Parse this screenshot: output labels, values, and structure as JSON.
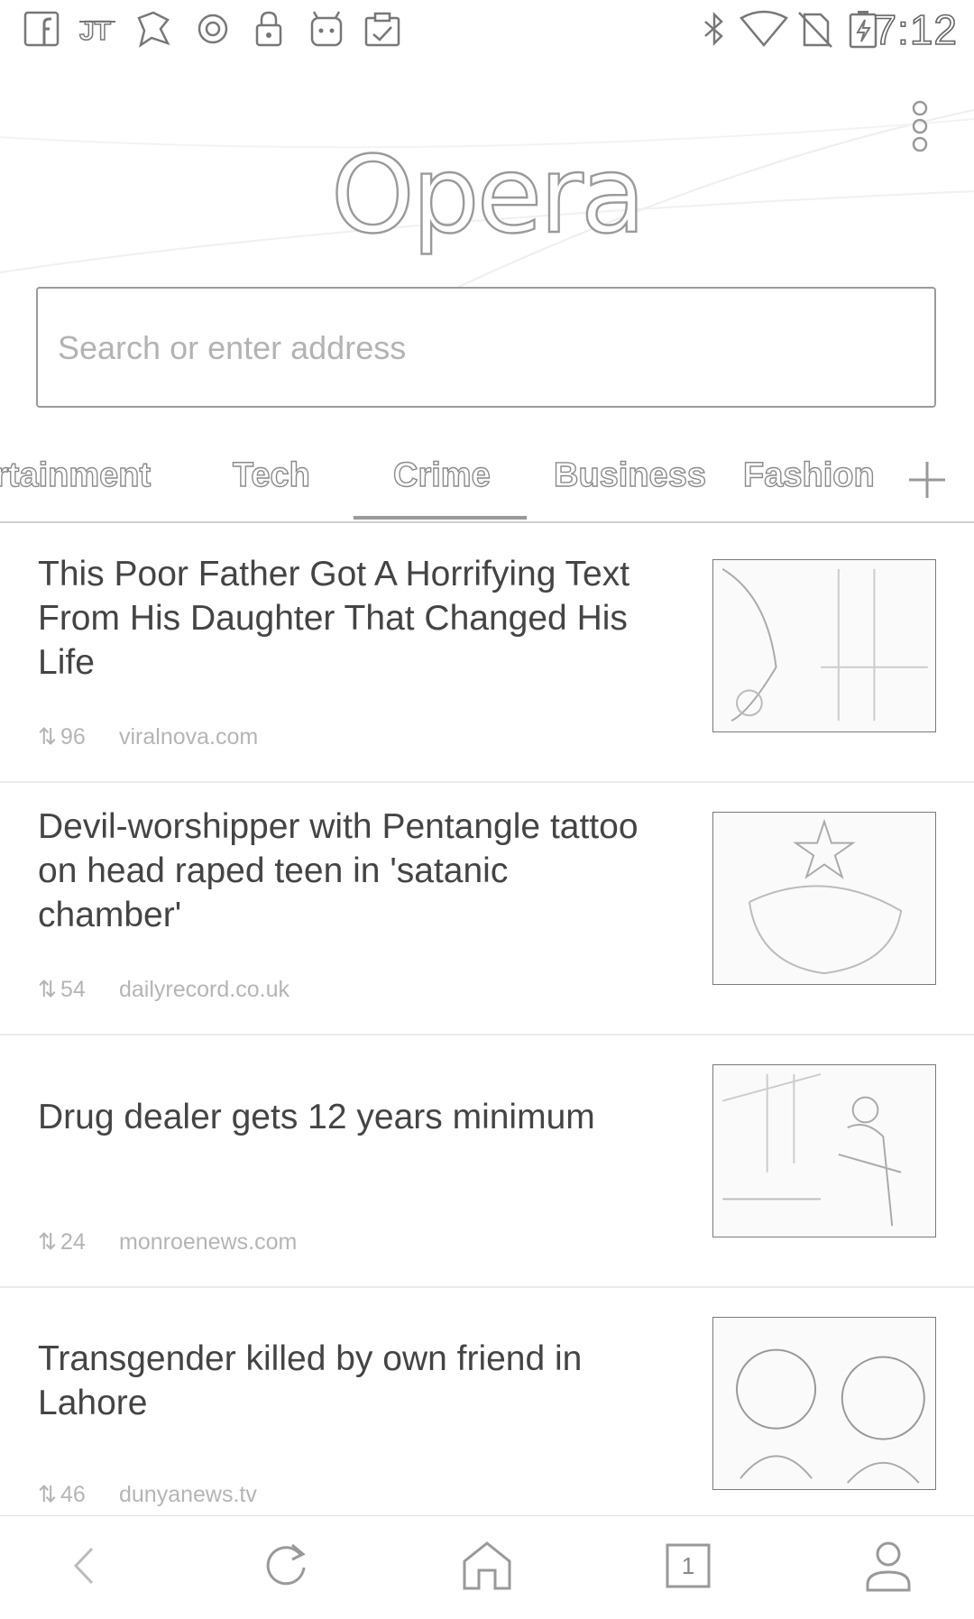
{
  "status_bar": {
    "time": "7:12",
    "left_icons": [
      "facebook-icon",
      "jt-app-icon",
      "app-icon",
      "circle-icon",
      "lock-icon",
      "robot-icon",
      "clipboard-check-icon"
    ],
    "right_icons": [
      "bluetooth-icon",
      "wifi-icon",
      "no-sim-icon",
      "battery-charging-icon"
    ]
  },
  "header": {
    "logo": "Opera"
  },
  "search": {
    "placeholder": "Search or enter address",
    "value": ""
  },
  "categories": {
    "items": [
      "rtainment",
      "Tech",
      "Crime",
      "Business",
      "Fashion"
    ],
    "selected": "Crime"
  },
  "feed": {
    "items": [
      {
        "title": "This Poor Father Got A Horrifying Text From His Daughter That Changed His Life",
        "shares": "96",
        "source": "viralnova.com"
      },
      {
        "title": "Devil-worshipper with Pentangle tattoo on head raped teen in 'satanic chamber'",
        "shares": "54",
        "source": "dailyrecord.co.uk"
      },
      {
        "title": "Drug dealer gets 12 years minimum",
        "shares": "24",
        "source": "monroenews.com"
      },
      {
        "title": "Transgender killed by own friend in Lahore",
        "shares": "46",
        "source": "dunyanews.tv"
      }
    ]
  },
  "bottom_bar": {
    "tab_count": "1",
    "icons": [
      "back-icon",
      "reload-icon",
      "home-icon",
      "tabs-icon",
      "profile-icon"
    ]
  }
}
